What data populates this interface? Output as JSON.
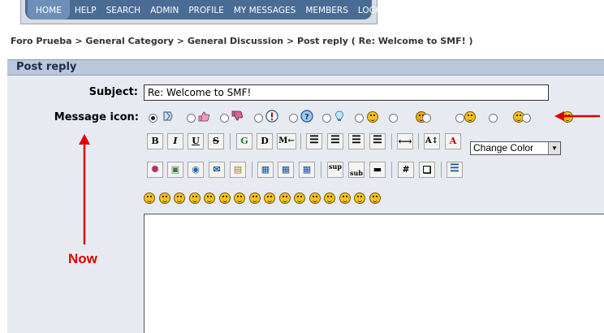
{
  "nav": {
    "items": [
      "HOME",
      "HELP",
      "SEARCH",
      "ADMIN",
      "PROFILE",
      "MY MESSAGES",
      "MEMBERS",
      "LOGOUT"
    ],
    "active": "HOME"
  },
  "breadcrumb": {
    "items": [
      "Foro Prueba",
      "General Category",
      "General Discussion",
      "Post reply ( Re: Welcome to SMF! )"
    ],
    "separator": ">"
  },
  "title": "Post reply",
  "form": {
    "subject_label": "Subject:",
    "subject_value": "Re: Welcome to SMF!",
    "icon_label": "Message icon:"
  },
  "message_icons": [
    "xx-icon",
    "thumbup-icon",
    "thumbdown-icon",
    "exclamation-icon",
    "question-icon",
    "lamp-icon",
    "smiley-icon",
    "angry-icon",
    "cheesy-icon",
    "laugh-icon",
    "sad-icon",
    "wink-icon"
  ],
  "color_select": {
    "selected": "Change Color"
  },
  "annotation": {
    "text": "Now",
    "color": "#e10000"
  },
  "colors": {
    "nav": "#4a6b94",
    "titlebar": "#b9c8dc",
    "panel": "#e7ebf1"
  }
}
